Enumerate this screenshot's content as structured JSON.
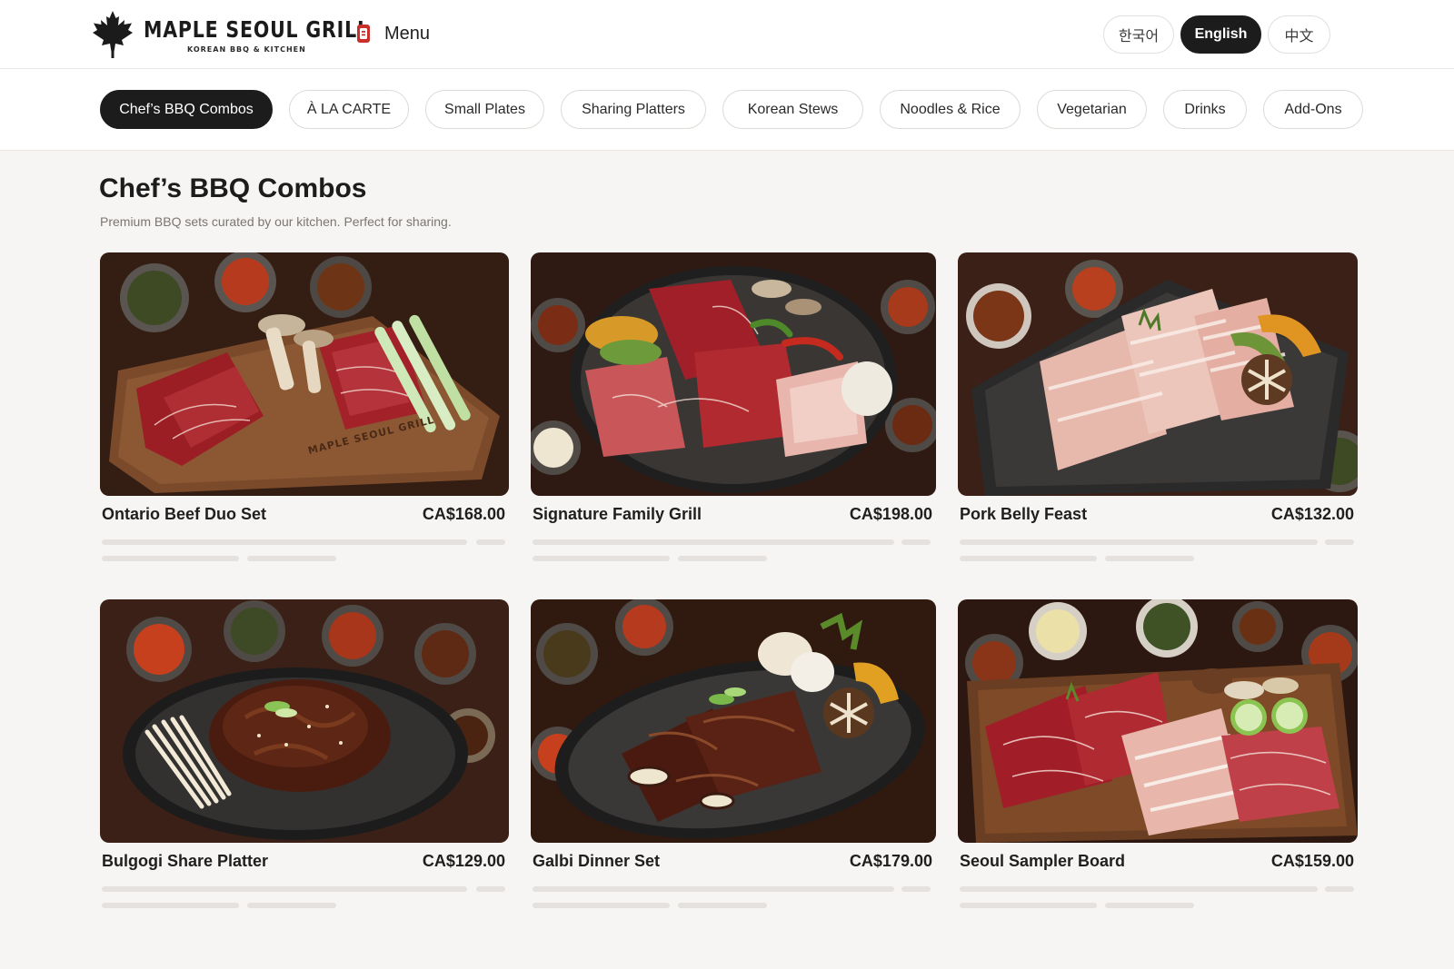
{
  "header": {
    "brand_name": "MAPLE SEOUL GRILL",
    "brand_tagline": "KOREAN BBQ & KITCHEN",
    "menu_label": "Menu",
    "languages": [
      "한국어",
      "English",
      "中文"
    ],
    "active_language": "English"
  },
  "categories": {
    "items": [
      "Chef’s BBQ Combos",
      "À LA CARTE",
      "Small Plates",
      "Sharing Platters",
      "Korean Stews",
      "Noodles & Rice",
      "Vegetarian",
      "Drinks",
      "Add-Ons"
    ],
    "active": "Chef’s BBQ Combos"
  },
  "section": {
    "title": "Chef’s BBQ Combos",
    "description": "Premium BBQ sets curated by our kitchen. Perfect for sharing."
  },
  "products": [
    {
      "name": "Ontario Beef Duo Set",
      "price": "CA$168.00",
      "image": "marbled beef slices on wooden board with king oyster mushrooms, green onion and banchan",
      "board_engraving": "MAPLE SEOUL GRILL"
    },
    {
      "name": "Signature Family Grill",
      "price": "CA$198.00",
      "image": "round grill plate with assorted beef, pork belly, mushrooms, peppers and squash"
    },
    {
      "name": "Pork Belly Feast",
      "price": "CA$132.00",
      "image": "pork belly slices on dark stone slab with pumpkin and shiitake"
    },
    {
      "name": "Bulgogi Share Platter",
      "price": "CA$129.00",
      "image": "marinated bulgogi on dark plate with enoki mushrooms and sesame"
    },
    {
      "name": "Galbi Dinner Set",
      "price": "CA$179.00",
      "image": "grilled galbi short ribs on oval plate with mushrooms and squash"
    },
    {
      "name": "Seoul Sampler Board",
      "price": "CA$159.00",
      "image": "raw beef and pork cuts on wooden board with mushrooms and cucumber"
    }
  ],
  "colors": {
    "active_pill": "#1c1c1c",
    "page_bg": "#f7f5f3",
    "accent_red": "#c8302c"
  },
  "icons": {
    "logo": "maple-leaf-icon",
    "menu": "menu-book-icon"
  }
}
